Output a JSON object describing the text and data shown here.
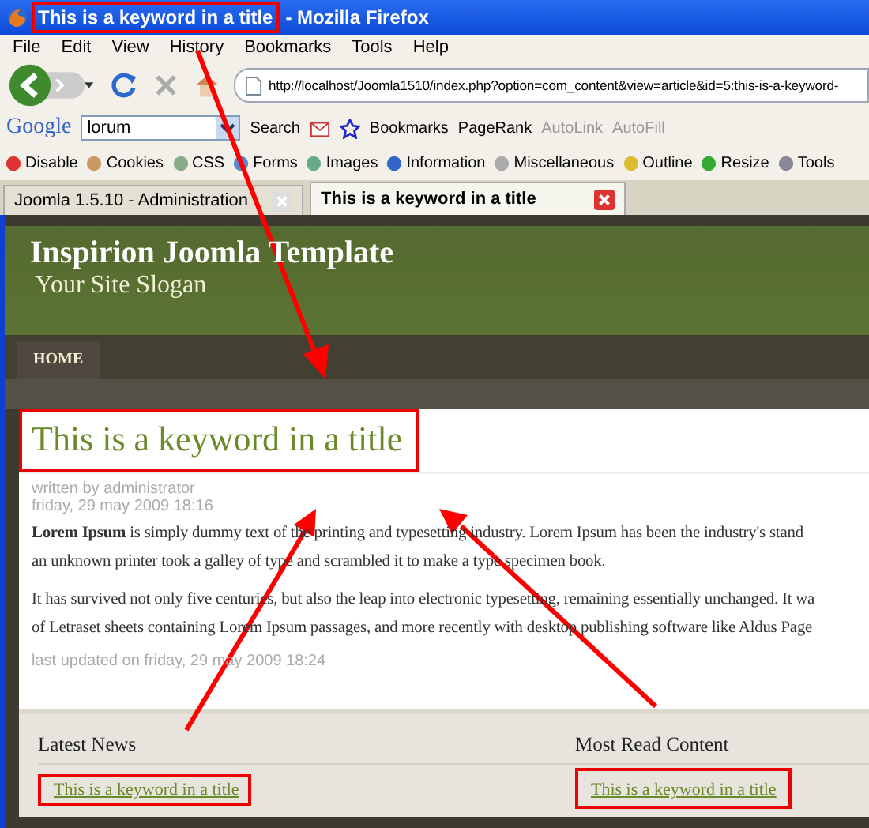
{
  "window": {
    "title": "This is a keyword in a title",
    "app": "- Mozilla Firefox"
  },
  "menu": [
    "File",
    "Edit",
    "View",
    "History",
    "Bookmarks",
    "Tools",
    "Help"
  ],
  "address": {
    "value": "http://localhost/Joomla1510/index.php?option=com_content&view=article&id=5:this-is-a-keyword-"
  },
  "google_toolbar": {
    "logo": "Google",
    "query": "lorum",
    "items": [
      {
        "label": "Search",
        "disabled": false
      },
      {
        "label": "Bookmarks",
        "disabled": false
      },
      {
        "label": "PageRank",
        "disabled": false
      },
      {
        "label": "AutoLink",
        "disabled": true
      },
      {
        "label": "AutoFill",
        "disabled": true
      }
    ]
  },
  "developer_toolbar": [
    "Disable",
    "Cookies",
    "CSS",
    "Forms",
    "Images",
    "Information",
    "Miscellaneous",
    "Outline",
    "Resize",
    "Tools"
  ],
  "tabs": [
    {
      "label": "Joomla 1.5.10 - Administration",
      "selected": false
    },
    {
      "label": "This is a keyword in a title",
      "selected": true
    }
  ],
  "site": {
    "title": "Inspirion Joomla Template",
    "slogan": "Your Site Slogan",
    "nav": [
      "HOME"
    ]
  },
  "article": {
    "title": "This is a keyword in a title",
    "author": "written by administrator",
    "date": "friday, 29 may 2009 18:16",
    "paragraphs": [
      "**Lorem Ipsum** is simply dummy text of the printing and typesetting industry. Lorem Ipsum has been the industry's stand",
      "an unknown printer took a galley of type and scrambled it to make a type specimen book.",
      "It has survived not only five centuries, but also the leap into electronic typesetting, remaining essentially unchanged. It wa",
      "of Letraset sheets containing Lorem Ipsum passages, and more recently with desktop publishing software like Aldus Page"
    ],
    "updated": "last updated on friday, 29 may 2009 18:24"
  },
  "modules": [
    {
      "title": "Latest News",
      "links": [
        "This is a keyword in a title"
      ]
    },
    {
      "title": "Most Read Content",
      "links": [
        "This is a keyword in a title"
      ]
    }
  ]
}
